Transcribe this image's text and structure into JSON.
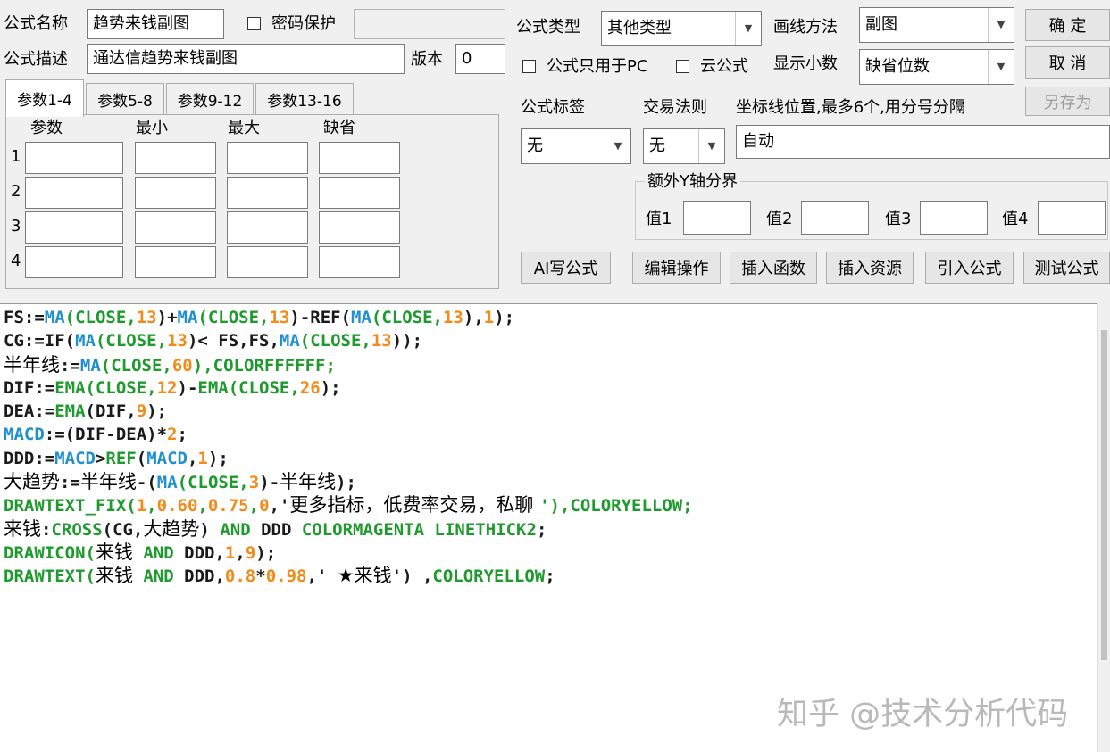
{
  "top": {
    "name_label": "公式名称",
    "name_value": "趋势来钱副图",
    "password_label": "密码保护",
    "password_value": "",
    "desc_label": "公式描述",
    "desc_value": "通达信趋势来钱副图",
    "version_label": "版本",
    "version_value": "0",
    "type_label": "公式类型",
    "type_value": "其他类型",
    "draw_label": "画线方法",
    "draw_value": "副图",
    "pc_only_label": "公式只用于PC",
    "cloud_label": "云公式",
    "decimal_label": "显示小数",
    "decimal_value": "缺省位数",
    "ok_button": "确  定",
    "cancel_button": "取  消",
    "save_as_button": "另存为"
  },
  "tabs": [
    "参数1-4",
    "参数5-8",
    "参数9-12",
    "参数13-16"
  ],
  "params": {
    "headers": [
      "参数",
      "最小",
      "最大",
      "缺省"
    ],
    "rows": [
      "1",
      "2",
      "3",
      "4"
    ]
  },
  "right": {
    "tag_label": "公式标签",
    "tag_value": "无",
    "rule_label": "交易法则",
    "rule_value": "无",
    "coord_label": "坐标线位置,最多6个,用分号分隔",
    "coord_value": "自动",
    "extra_y_label": "额外Y轴分界",
    "v1": "值1",
    "v2": "值2",
    "v3": "值3",
    "v4": "值4"
  },
  "buttons": {
    "ai": "AI写公式",
    "edit": "编辑操作",
    "insert_func": "插入函数",
    "insert_res": "插入资源",
    "import": "引入公式",
    "test": "测试公式"
  },
  "code_lines": [
    [
      [
        "FS:=",
        "k"
      ],
      [
        "MA",
        "b"
      ],
      [
        "(CLOSE,",
        "g"
      ],
      [
        "13",
        "o"
      ],
      [
        ")+",
        "k"
      ],
      [
        "MA",
        "b"
      ],
      [
        "(CLOSE,",
        "g"
      ],
      [
        "13",
        "o"
      ],
      [
        ")-REF(",
        "k"
      ],
      [
        "MA",
        "b"
      ],
      [
        "(CLOSE,",
        "g"
      ],
      [
        "13",
        "o"
      ],
      [
        "),",
        "k"
      ],
      [
        "1",
        "o"
      ],
      [
        ");",
        "k"
      ]
    ],
    [
      [
        "CG:=IF(",
        "k"
      ],
      [
        "MA",
        "b"
      ],
      [
        "(CLOSE,",
        "g"
      ],
      [
        "13",
        "o"
      ],
      [
        ")< FS,FS,",
        "k"
      ],
      [
        "MA",
        "b"
      ],
      [
        "(CLOSE,",
        "g"
      ],
      [
        "13",
        "o"
      ],
      [
        "));",
        "k"
      ]
    ],
    [
      [
        "半年线",
        "c"
      ],
      [
        ":=",
        "k"
      ],
      [
        "MA",
        "b"
      ],
      [
        "(CLOSE,",
        "g"
      ],
      [
        "60",
        "o"
      ],
      [
        "),COLORFFFFFF;",
        "g"
      ]
    ],
    [
      [
        "DIF:=",
        "k"
      ],
      [
        "EMA",
        "g"
      ],
      [
        "(CLOSE,",
        "g"
      ],
      [
        "12",
        "o"
      ],
      [
        ")-",
        "k"
      ],
      [
        "EMA",
        "g"
      ],
      [
        "(CLOSE,",
        "g"
      ],
      [
        "26",
        "o"
      ],
      [
        ");",
        "k"
      ]
    ],
    [
      [
        "DEA:=",
        "k"
      ],
      [
        "EMA",
        "g"
      ],
      [
        "(DIF,",
        "k"
      ],
      [
        "9",
        "o"
      ],
      [
        ");",
        "k"
      ]
    ],
    [
      [
        "MACD",
        "b"
      ],
      [
        ":=(DIF-DEA)*",
        "k"
      ],
      [
        "2",
        "o"
      ],
      [
        ";",
        "k"
      ]
    ],
    [
      [
        "DDD:=",
        "k"
      ],
      [
        "MACD",
        "b"
      ],
      [
        ">",
        "k"
      ],
      [
        "REF",
        "g"
      ],
      [
        "(",
        "k"
      ],
      [
        "MACD",
        "b"
      ],
      [
        ",",
        "k"
      ],
      [
        "1",
        "o"
      ],
      [
        ");",
        "k"
      ]
    ],
    [
      [
        "大趋势",
        "c"
      ],
      [
        ":=",
        "k"
      ],
      [
        "半年线",
        "c"
      ],
      [
        "-(",
        "k"
      ],
      [
        "MA",
        "b"
      ],
      [
        "(CLOSE,",
        "g"
      ],
      [
        "3",
        "o"
      ],
      [
        ")-",
        "k"
      ],
      [
        "半年线",
        "c"
      ],
      [
        ");",
        "k"
      ]
    ],
    [
      [
        "DRAWTEXT_FIX(",
        "g"
      ],
      [
        "1",
        "o"
      ],
      [
        ",",
        "g"
      ],
      [
        "0.60",
        "o"
      ],
      [
        ",",
        "g"
      ],
      [
        "0.75",
        "o"
      ],
      [
        ",",
        "g"
      ],
      [
        "0",
        "o"
      ],
      [
        ",'",
        "k"
      ],
      [
        "更多指标，低费率交易，私聊 ",
        "c"
      ],
      [
        "'),COLORYELLOW;",
        "g"
      ]
    ],
    [
      [
        "来钱",
        "c"
      ],
      [
        ":",
        "k"
      ],
      [
        "CROSS",
        "g"
      ],
      [
        "(CG,",
        "k"
      ],
      [
        "大趋势",
        "c"
      ],
      [
        ") ",
        "k"
      ],
      [
        "AND",
        "g"
      ],
      [
        " DDD ",
        "k"
      ],
      [
        "COLORMAGENTA LINETHICK2",
        "g"
      ],
      [
        ";",
        "k"
      ]
    ],
    [
      [
        "DRAWICON(",
        "g"
      ],
      [
        "来钱",
        "c"
      ],
      [
        " AND ",
        "g"
      ],
      [
        "DDD,",
        "k"
      ],
      [
        "1",
        "o"
      ],
      [
        ",",
        "k"
      ],
      [
        "9",
        "o"
      ],
      [
        ");",
        "k"
      ]
    ],
    [
      [
        "DRAWTEXT(",
        "g"
      ],
      [
        "来钱",
        "c"
      ],
      [
        " AND ",
        "g"
      ],
      [
        "DDD,",
        "k"
      ],
      [
        "0.8",
        "o"
      ],
      [
        "*",
        "k"
      ],
      [
        "0.98",
        "o"
      ],
      [
        ",' ",
        "k"
      ],
      [
        "★来钱",
        "c"
      ],
      [
        "') ,",
        "k"
      ],
      [
        "COLORYELLOW",
        "g"
      ],
      [
        ";",
        "k"
      ]
    ]
  ],
  "colors": {
    "k": "#1a1a1a",
    "b": "#1f8fd0",
    "g": "#1f9a2e",
    "o": "#f08c1a",
    "c": "#000000"
  },
  "watermark": "知乎 @技术分析代码"
}
